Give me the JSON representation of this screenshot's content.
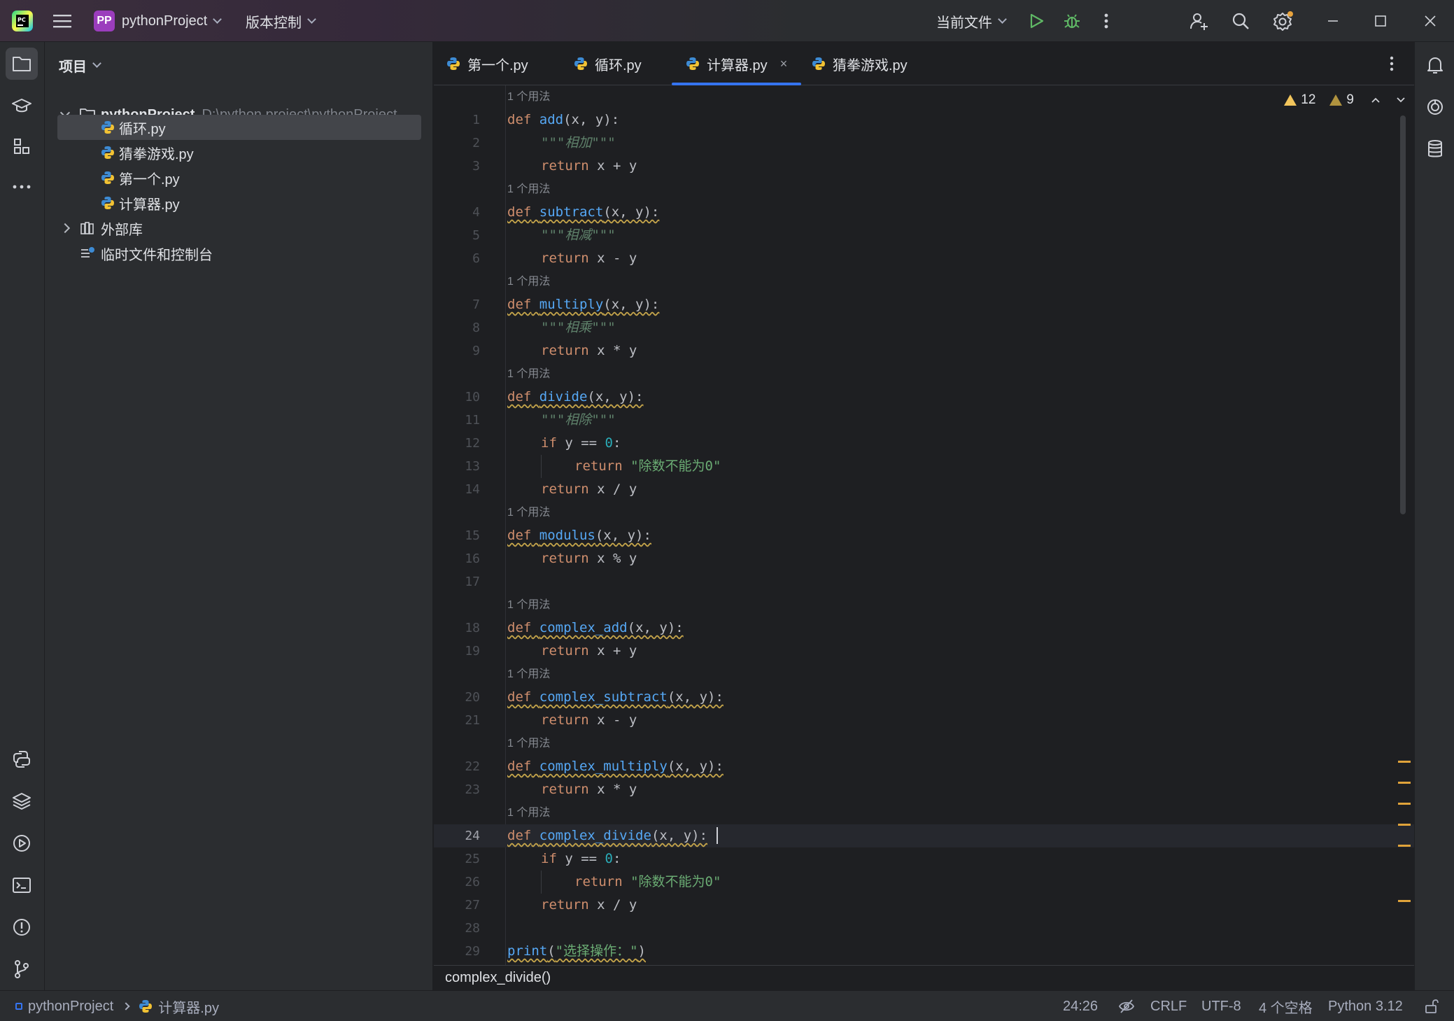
{
  "titlebar": {
    "project_badge": "PP",
    "project_name": "pythonProject",
    "vcs_menu": "版本控制",
    "run_config": "当前文件"
  },
  "project_panel": {
    "header": "项目",
    "root_name": "pythonProject",
    "root_path": "D:\\python project\\pythonProject",
    "files": [
      "循环.py",
      "猜拳游戏.py",
      "第一个.py",
      "计算器.py"
    ],
    "external_libs": "外部库",
    "scratches": "临时文件和控制台"
  },
  "tabs": [
    {
      "label": "第一个.py"
    },
    {
      "label": "循环.py"
    },
    {
      "label": "计算器.py",
      "close": "×"
    },
    {
      "label": "猜拳游戏.py"
    }
  ],
  "inspection": {
    "warnings": "12",
    "weak_warnings": "9"
  },
  "usage_hint": "1 个用法",
  "code": {
    "line_numbers": [
      "1",
      "2",
      "3",
      "4",
      "5",
      "6",
      "7",
      "8",
      "9",
      "10",
      "11",
      "12",
      "13",
      "14",
      "15",
      "16",
      "17",
      "18",
      "19",
      "20",
      "21",
      "22",
      "23",
      "24",
      "25",
      "26",
      "27",
      "28",
      "29"
    ],
    "funcs": [
      "add",
      "subtract",
      "multiply",
      "divide",
      "modulus",
      "complex_add",
      "complex_subtract",
      "complex_multiply",
      "complex_divide",
      "print"
    ],
    "kw_def": "def",
    "kw_return": "return",
    "kw_if": "if",
    "params": "(x, y):",
    "doc_add": "\"\"\"相加\"\"\"",
    "doc_subtract": "\"\"\"相减\"\"\"",
    "doc_multiply": "\"\"\"相乘\"\"\"",
    "doc_divide": "\"\"\"相除\"\"\"",
    "expr_add": "x + y",
    "expr_sub": "x - y",
    "expr_mul": "x * y",
    "expr_div": "x / y",
    "expr_mod": "x % y",
    "cond": "y == ",
    "zero": "0",
    "colon": ":",
    "div_error": "\"除数不能为0\"",
    "print_open": "(",
    "print_arg": "\"选择操作：\"",
    "print_close": ")"
  },
  "editor_breadcrumb": "complex_divide()",
  "statusbar": {
    "project": "pythonProject",
    "file": "计算器.py",
    "position": "24:26",
    "line_sep": "CRLF",
    "encoding": "UTF-8",
    "indent": "4 个空格",
    "interpreter": "Python 3.12"
  },
  "colors": {
    "accent": "#3574f0",
    "keyword": "#cf8e6d",
    "function": "#56a8f5",
    "string": "#6aab73",
    "number": "#2aacb8",
    "warning": "#f2c55c"
  }
}
